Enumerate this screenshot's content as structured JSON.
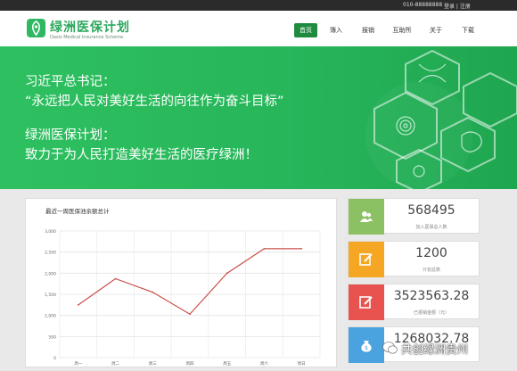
{
  "topbar": {
    "phone": "010-88888888",
    "login": "登录 | 注册"
  },
  "brand": {
    "name_cn": "绿洲医保计划",
    "name_en": "Oasis Medical Insurance Scheme",
    "color": "#2fb763"
  },
  "nav": {
    "items": [
      {
        "label": "首页",
        "active": true
      },
      {
        "label": "簿入"
      },
      {
        "label": "报销"
      },
      {
        "label": "互助所"
      },
      {
        "label": "关于"
      },
      {
        "label": "下载"
      }
    ]
  },
  "banner": {
    "line1": "习近平总书记：",
    "line2": "“永远把人民对美好生活的向往作为奋斗目标”",
    "line3": "绿洲医保计划：",
    "line4": "致力于为人民打造美好生活的医疗绿洲！"
  },
  "chart_data": {
    "type": "line",
    "title": "最近一周医保池余额总计",
    "categories": [
      "周一",
      "周二",
      "周三",
      "周四",
      "周五",
      "周六",
      "周日"
    ],
    "values": [
      1250,
      1870,
      1550,
      1030,
      2000,
      2580,
      2580
    ],
    "ylim": [
      0,
      3000
    ],
    "yticks": [
      "0",
      "500",
      "1,000",
      "1,500",
      "2,000",
      "2,500",
      "3,000"
    ],
    "line_color": "#c9504a",
    "grid": true
  },
  "stats": [
    {
      "value": "568495",
      "label": "加入医保总人数",
      "color": "#8cc163",
      "icon": "users-icon"
    },
    {
      "value": "1200",
      "label": "计划总数",
      "color": "#f5a623",
      "icon": "edit-icon"
    },
    {
      "value": "3523563.28",
      "label": "已报销金额（元）",
      "color": "#e9534f",
      "icon": "edit-icon"
    },
    {
      "value": "1268032.78",
      "label": "",
      "color": "#4aa3df",
      "icon": "money-bag-icon"
    }
  ],
  "watermark": "共创绿洲贵州"
}
